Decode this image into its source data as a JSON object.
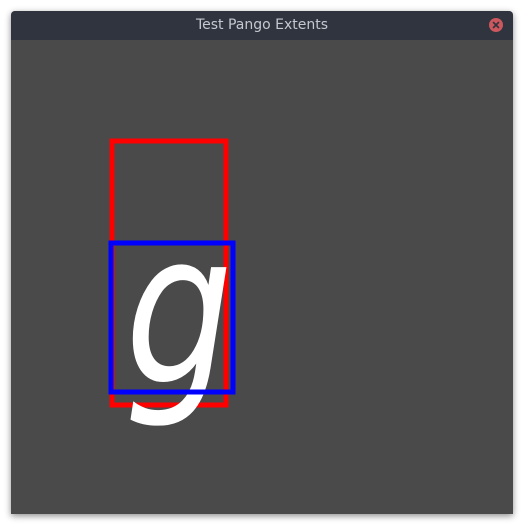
{
  "window": {
    "title": "Test Pango Extents"
  },
  "icons": {
    "close": "close-icon"
  },
  "canvas": {
    "glyph": "g",
    "ink_rect_color": "#0000ff",
    "logical_rect_color": "#ff0000",
    "glyph_color": "#ffffff",
    "background": "#4a4a4a"
  }
}
